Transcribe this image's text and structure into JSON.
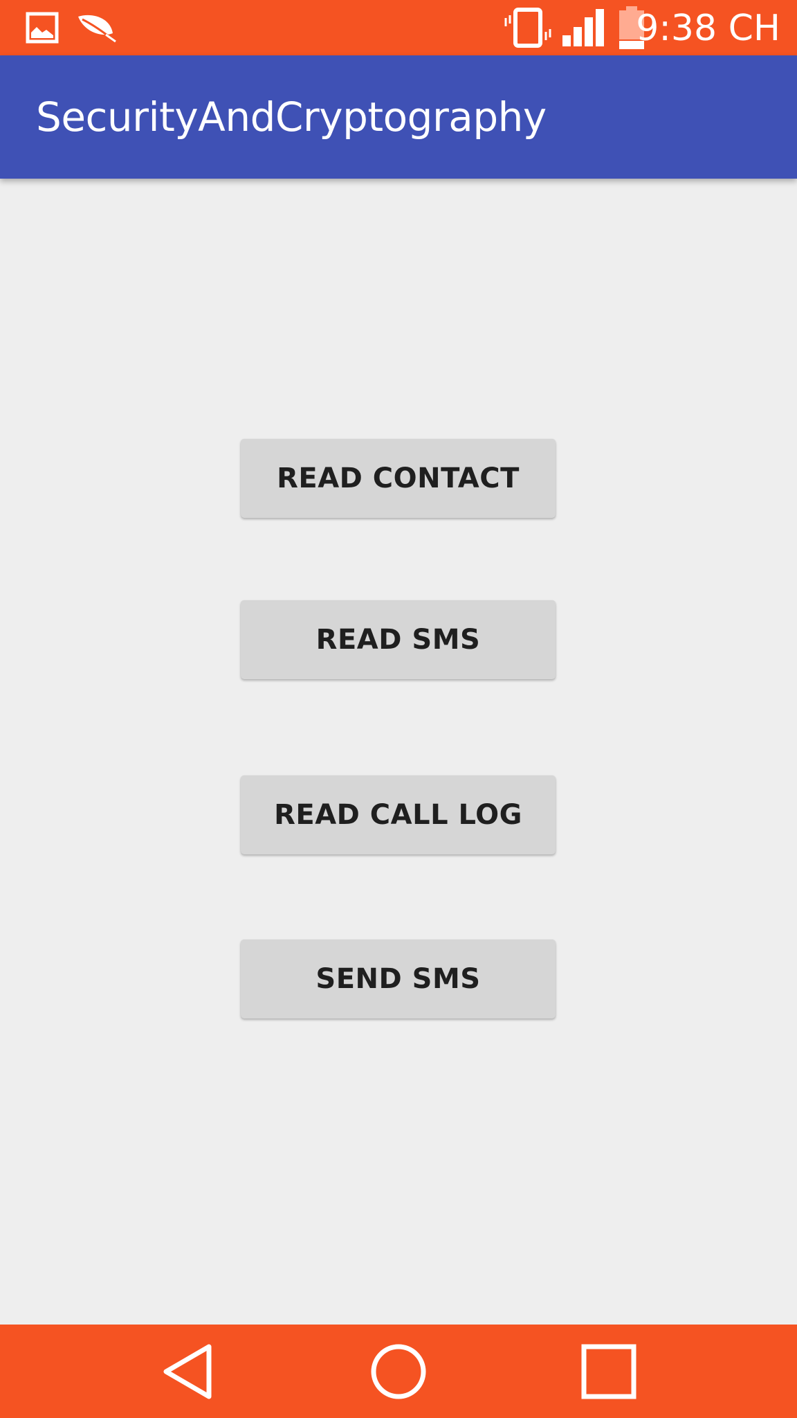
{
  "status_bar": {
    "time": "9:38 CH",
    "icons": [
      "image-icon",
      "leaf-icon",
      "vibrate-icon",
      "signal-icon",
      "battery-icon"
    ],
    "color": "#f55322"
  },
  "app_bar": {
    "title": "SecurityAndCryptography",
    "color": "#3f51b5"
  },
  "buttons": [
    {
      "label": "READ CONTACT"
    },
    {
      "label": "READ SMS"
    },
    {
      "label": "READ CALL LOG"
    },
    {
      "label": "SEND SMS"
    }
  ],
  "nav_bar": {
    "icons": [
      "back-icon",
      "home-icon",
      "recents-icon"
    ],
    "color": "#f55322"
  }
}
